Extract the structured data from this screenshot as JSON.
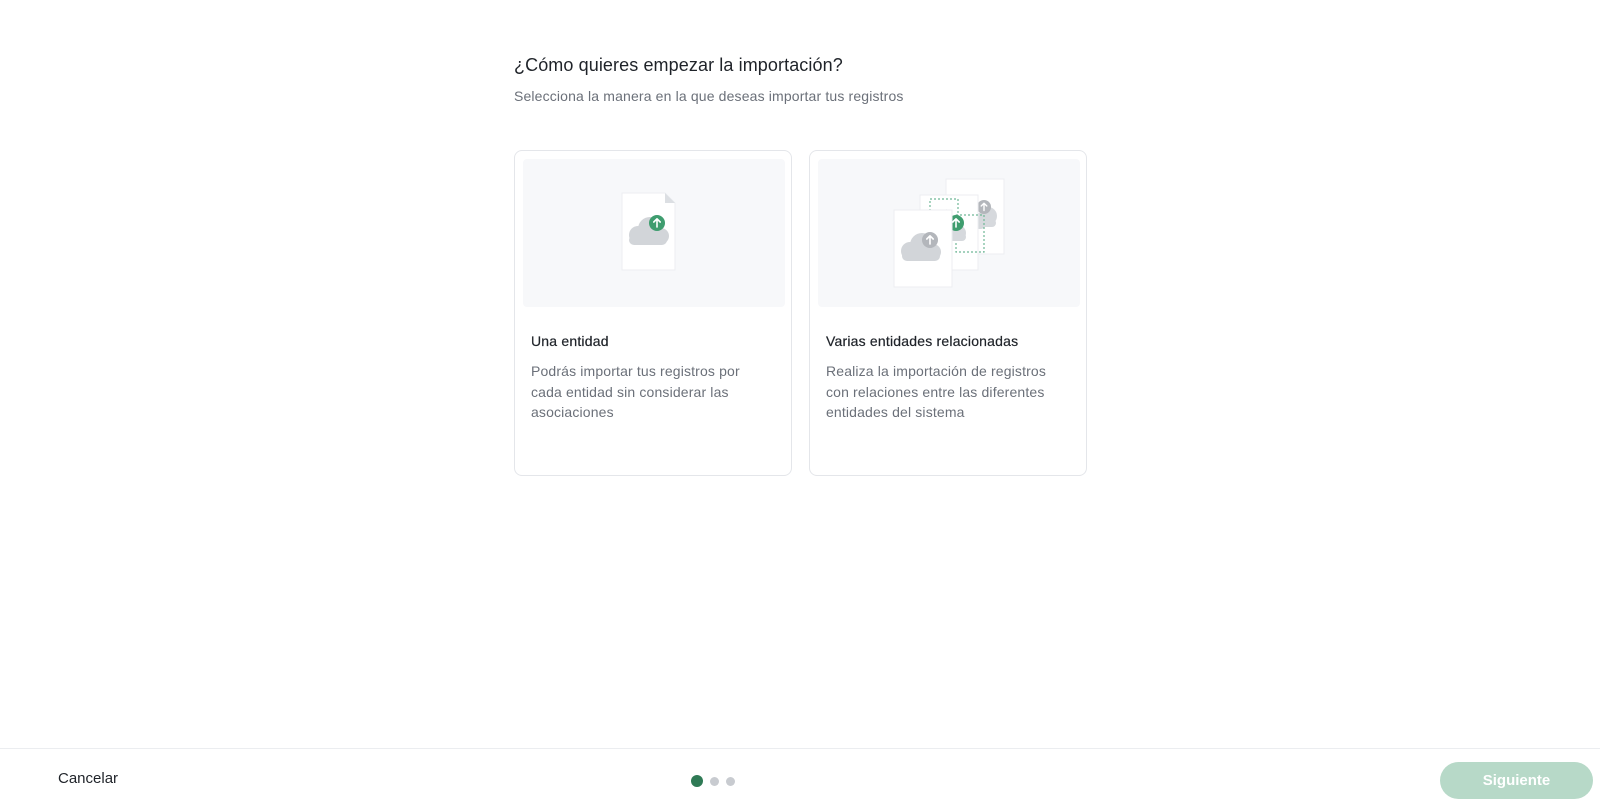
{
  "header": {
    "title": "¿Cómo quieres empezar la importación?",
    "subtitle": "Selecciona la manera en la que deseas importar tus registros"
  },
  "options": [
    {
      "title": "Una entidad",
      "description": "Podrás importar tus registros por cada entidad sin considerar las asociaciones",
      "illustration": "single-file-upload-icon"
    },
    {
      "title": "Varias entidades relacionadas",
      "description": "Realiza la importación de registros con relaciones entre las diferentes entidades del sistema",
      "illustration": "multiple-files-upload-icon"
    }
  ],
  "footer": {
    "cancel_label": "Cancelar",
    "next_label": "Siguiente",
    "steps_total": 3,
    "current_step": 1
  },
  "colors": {
    "accent": "#2f7a55",
    "accent_disabled": "#b7d9c8",
    "upload_badge_green": "#3f9d6f",
    "upload_badge_gray": "#b3b6bb"
  }
}
